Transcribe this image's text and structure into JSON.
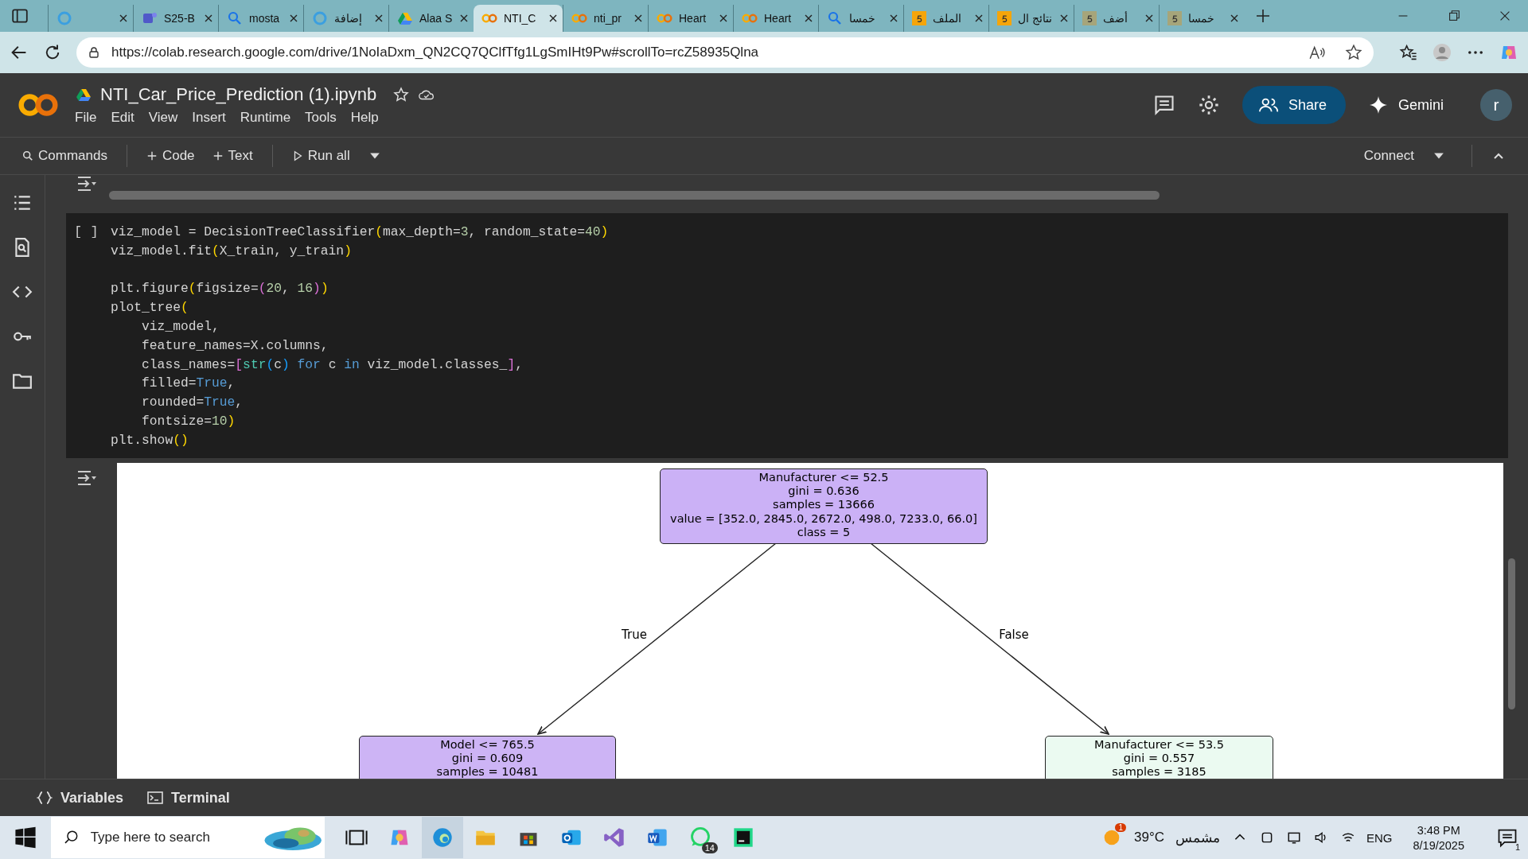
{
  "browser": {
    "tabs": [
      {
        "kind": "ring",
        "selected": false
      },
      {
        "title": "S25-B",
        "kind": "teams",
        "selected": false
      },
      {
        "title": "mosta",
        "kind": "search",
        "selected": false
      },
      {
        "title": "إضافة",
        "kind": "ring",
        "selected": false
      },
      {
        "title": "Alaa S",
        "kind": "drive",
        "selected": false
      },
      {
        "title": "NTI_C",
        "kind": "colab",
        "selected": true
      },
      {
        "title": "nti_pr",
        "kind": "colab",
        "selected": false
      },
      {
        "title": "Heart",
        "kind": "colab",
        "selected": false
      },
      {
        "title": "Heart",
        "kind": "colab",
        "selected": false
      },
      {
        "title": "خمسا",
        "kind": "search",
        "selected": false
      },
      {
        "title": "الملف",
        "kind": "five",
        "selected": false
      },
      {
        "title": "نتائج ال",
        "kind": "five",
        "selected": false
      },
      {
        "title": "أضف",
        "kind": "fivegray",
        "selected": false
      },
      {
        "title": "خمسا",
        "kind": "fivegray",
        "selected": false
      }
    ],
    "url": "https://colab.research.google.com/drive/1NoIaDxm_QN2CQ7QClfTfg1LgSmIHt9Pw#scrollTo=rcZ58935Qlna"
  },
  "notebook": {
    "title": "NTI_Car_Price_Prediction (1).ipynb",
    "menus": [
      "File",
      "Edit",
      "View",
      "Insert",
      "Runtime",
      "Tools",
      "Help"
    ],
    "share": "Share",
    "gemini": "Gemini",
    "avatar": "r"
  },
  "toolbar": {
    "commands": "Commands",
    "code": "Code",
    "text": "Text",
    "run_all": "Run all",
    "connect": "Connect"
  },
  "cell": {
    "bracket": "[ ]",
    "blocks": [
      [
        [
          {
            "t": "viz_model = DecisionTreeClassifier",
            "kind": "plain"
          },
          {
            "t": "(",
            "kind": "p1"
          },
          {
            "t": "max_depth=",
            "kind": "plain"
          },
          {
            "t": "3",
            "kind": "num"
          },
          {
            "t": ", random_state=",
            "kind": "plain"
          },
          {
            "t": "40",
            "kind": "num"
          },
          {
            "t": ")",
            "kind": "p1"
          }
        ],
        [
          {
            "t": "viz_model.fit",
            "kind": "plain"
          },
          {
            "t": "(",
            "kind": "p1"
          },
          {
            "t": "X_train, y_train",
            "kind": "plain"
          },
          {
            "t": ")",
            "kind": "p1"
          }
        ]
      ],
      [
        [
          {
            "t": "plt.figure",
            "kind": "plain"
          },
          {
            "t": "(",
            "kind": "p1"
          },
          {
            "t": "figsize=",
            "kind": "plain"
          },
          {
            "t": "(",
            "kind": "p2"
          },
          {
            "t": "20",
            "kind": "num"
          },
          {
            "t": ", ",
            "kind": "plain"
          },
          {
            "t": "16",
            "kind": "num"
          },
          {
            "t": ")",
            "kind": "p2"
          },
          {
            "t": ")",
            "kind": "p1"
          }
        ],
        [
          {
            "t": "plot_tree",
            "kind": "plain"
          },
          {
            "t": "(",
            "kind": "p1"
          }
        ],
        [
          {
            "t": "    viz_model,",
            "kind": "plain"
          }
        ],
        [
          {
            "t": "    feature_names=X.columns,",
            "kind": "plain"
          }
        ],
        [
          {
            "t": "    class_names=",
            "kind": "plain"
          },
          {
            "t": "[",
            "kind": "p2"
          },
          {
            "t": "str",
            "kind": "builtin"
          },
          {
            "t": "(",
            "kind": "p3"
          },
          {
            "t": "c",
            "kind": "plain"
          },
          {
            "t": ")",
            "kind": "p3"
          },
          {
            "t": " for ",
            "kind": "kw"
          },
          {
            "t": "c",
            "kind": "plain"
          },
          {
            "t": " in ",
            "kind": "kw"
          },
          {
            "t": "viz_model.classes_",
            "kind": "plain"
          },
          {
            "t": "]",
            "kind": "p2"
          },
          {
            "t": ",",
            "kind": "plain"
          }
        ],
        [
          {
            "t": "    filled=",
            "kind": "plain"
          },
          {
            "t": "True",
            "kind": "kw"
          },
          {
            "t": ",",
            "kind": "plain"
          }
        ],
        [
          {
            "t": "    rounded=",
            "kind": "plain"
          },
          {
            "t": "True",
            "kind": "kw"
          },
          {
            "t": ",",
            "kind": "plain"
          }
        ],
        [
          {
            "t": "    fontsize=",
            "kind": "plain"
          },
          {
            "t": "10",
            "kind": "num"
          },
          {
            "t": ")",
            "kind": "p1"
          }
        ],
        [
          {
            "t": "plt.show",
            "kind": "plain"
          },
          {
            "t": "()",
            "kind": "p1"
          }
        ]
      ]
    ]
  },
  "tree": {
    "lines": [
      "Manufacturer <= 52.5",
      "gini = 0.636",
      "samples = 13666",
      "value = [352.0, 2845.0, 2672.0, 498.0, 7233.0, 66.0]",
      "class = 5"
    ],
    "color": "#cbb1f6",
    "children": [
      {
        "edge_label": "True",
        "lines": [
          "Model <= 765.5",
          "gini = 0.609",
          "samples = 10481"
        ],
        "color": "#cdb4f5"
      },
      {
        "edge_label": "False",
        "lines": [
          "Manufacturer <= 53.5",
          "gini = 0.557",
          "samples = 3185"
        ],
        "color": "#ebfaf1"
      }
    ]
  },
  "bottom_bar": {
    "variables": "Variables",
    "terminal": "Terminal"
  },
  "taskbar": {
    "search_placeholder": "Type here to search",
    "whatsapp_badge": "14",
    "weather_badge": "1",
    "temperature": "39°C",
    "weather": "مشمس",
    "language": "ENG",
    "time": "3:48 PM",
    "date": "8/19/2025",
    "notifications": "1"
  }
}
